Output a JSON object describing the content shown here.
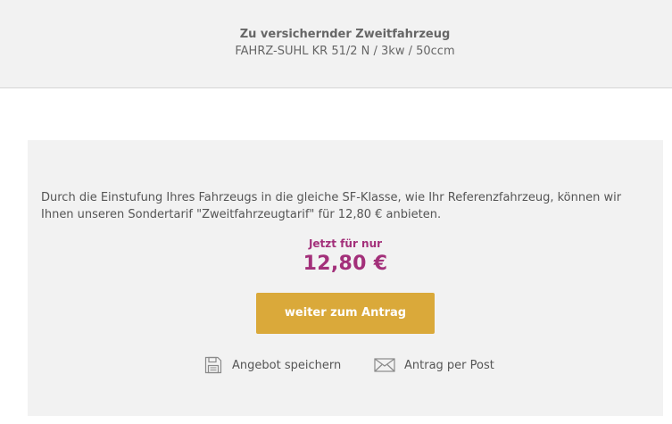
{
  "header": {
    "vehicle_title": "Zu versichernder Zweitfahrzeug",
    "vehicle_desc": "FAHRZ-SUHL KR 51/2 N / 3kw / 50ccm"
  },
  "offer": {
    "text": "Durch die Einstufung Ihres Fahrzeugs in die gleiche SF-Klasse, wie Ihr Referenzfahrzeug, können wir Ihnen unseren Sondertarif \"Zweitfahrzeugtarif\" für 12,80 € anbieten.",
    "price_caption": "Jetzt für nur",
    "price": "12,80 €",
    "continue_label": "weiter zum Antrag",
    "save_label": "Angebot speichern",
    "post_label": "Antrag per Post"
  },
  "icons": {
    "save": "floppy-disk-icon",
    "post": "envelope-icon"
  },
  "colors": {
    "accent": "#a3307a",
    "button": "#daa93a",
    "panel": "#f2f2f2"
  }
}
